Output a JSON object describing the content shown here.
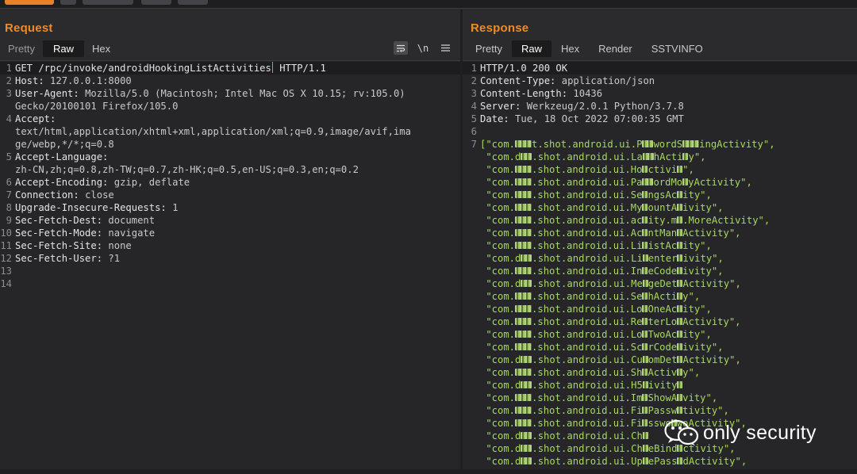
{
  "request": {
    "title": "Request",
    "tabs": [
      "Pretty",
      "Raw",
      "Hex"
    ],
    "active_tab": "Raw",
    "tools": [
      "wrap-icon",
      "newline-toggle",
      "menu-icon"
    ],
    "newline_label": "\\n",
    "lines": [
      {
        "n": "1",
        "parts": [
          [
            "txt",
            "GET /rpc/invoke/androidHookingListActivities"
          ],
          [
            "cursor",
            ""
          ],
          [
            "txt",
            " HTTP/1.1"
          ]
        ],
        "hl": true
      },
      {
        "n": "2",
        "parts": [
          [
            "key",
            "Host: "
          ],
          [
            "val",
            "127.0.0.1:8000"
          ]
        ]
      },
      {
        "n": "3",
        "parts": [
          [
            "key",
            "User-Agent: "
          ],
          [
            "val",
            "Mozilla/5.0 (Macintosh; Intel Mac OS X 10.15; rv:105.0)"
          ]
        ]
      },
      {
        "n": "",
        "parts": [
          [
            "val",
            "Gecko/20100101 Firefox/105.0"
          ]
        ]
      },
      {
        "n": "4",
        "parts": [
          [
            "key",
            "Accept:"
          ]
        ]
      },
      {
        "n": "",
        "parts": [
          [
            "val",
            "text/html,application/xhtml+xml,application/xml;q=0.9,image/avif,ima"
          ]
        ]
      },
      {
        "n": "",
        "parts": [
          [
            "val",
            "ge/webp,*/*;q=0.8"
          ]
        ]
      },
      {
        "n": "5",
        "parts": [
          [
            "key",
            "Accept-Language:"
          ]
        ]
      },
      {
        "n": "",
        "parts": [
          [
            "val",
            "zh-CN,zh;q=0.8,zh-TW;q=0.7,zh-HK;q=0.5,en-US;q=0.3,en;q=0.2"
          ]
        ]
      },
      {
        "n": "6",
        "parts": [
          [
            "key",
            "Accept-Encoding: "
          ],
          [
            "val",
            "gzip, deflate"
          ]
        ]
      },
      {
        "n": "7",
        "parts": [
          [
            "key",
            "Connection: "
          ],
          [
            "val",
            "close"
          ]
        ]
      },
      {
        "n": "8",
        "parts": [
          [
            "key",
            "Upgrade-Insecure-Requests: "
          ],
          [
            "val",
            "1"
          ]
        ]
      },
      {
        "n": "9",
        "parts": [
          [
            "key",
            "Sec-Fetch-Dest: "
          ],
          [
            "val",
            "document"
          ]
        ]
      },
      {
        "n": "10",
        "parts": [
          [
            "key",
            "Sec-Fetch-Mode: "
          ],
          [
            "val",
            "navigate"
          ]
        ]
      },
      {
        "n": "11",
        "parts": [
          [
            "key",
            "Sec-Fetch-Site: "
          ],
          [
            "val",
            "none"
          ]
        ]
      },
      {
        "n": "12",
        "parts": [
          [
            "key",
            "Sec-Fetch-User: "
          ],
          [
            "val",
            "?1"
          ]
        ]
      },
      {
        "n": "13",
        "parts": []
      },
      {
        "n": "14",
        "parts": []
      }
    ]
  },
  "response": {
    "title": "Response",
    "tabs": [
      "Pretty",
      "Raw",
      "Hex",
      "Render",
      "SSTVINFO"
    ],
    "active_tab": "Raw",
    "lines": [
      {
        "n": "1",
        "parts": [
          [
            "key",
            "HTTP/1.0 200 OK"
          ]
        ],
        "hl": true
      },
      {
        "n": "2",
        "parts": [
          [
            "key",
            "Content-Type: "
          ],
          [
            "val",
            "application/json"
          ]
        ]
      },
      {
        "n": "3",
        "parts": [
          [
            "key",
            "Content-Length: "
          ],
          [
            "val",
            "10436"
          ]
        ]
      },
      {
        "n": "4",
        "parts": [
          [
            "key",
            "Server: "
          ],
          [
            "val",
            "Werkzeug/2.0.1 Python/3.7.8"
          ]
        ]
      },
      {
        "n": "5",
        "parts": [
          [
            "key",
            "Date: "
          ],
          [
            "val",
            "Tue, 18 Oct 2022 07:00:35 GMT"
          ]
        ]
      },
      {
        "n": "6",
        "parts": []
      },
      {
        "n": "7",
        "parts": [
          [
            "str",
            "[\"com."
          ],
          [
            "blur",
            "3"
          ],
          [
            "str",
            "t.shot.android.ui.P"
          ],
          [
            "blur",
            "2"
          ],
          [
            "str",
            "wordS"
          ],
          [
            "blur",
            "3"
          ],
          [
            "str",
            "ingActivity\","
          ]
        ]
      },
      {
        "n": "",
        "parts": [
          [
            "str",
            " \"com.d"
          ],
          [
            "blur",
            "2"
          ],
          [
            "str",
            ".shot.android.ui.La"
          ],
          [
            "blur",
            "2"
          ],
          [
            "str",
            "hActi"
          ],
          [
            "blur",
            "1"
          ],
          [
            "str",
            "y\","
          ]
        ]
      },
      {
        "n": "",
        "parts": [
          [
            "str",
            " \"com."
          ],
          [
            "blur",
            "3"
          ],
          [
            "str",
            ".shot.android.ui.Ho"
          ],
          [
            "blur",
            "1"
          ],
          [
            "str",
            "ctivi"
          ],
          [
            "blur",
            "1"
          ],
          [
            "str",
            "\","
          ]
        ]
      },
      {
        "n": "",
        "parts": [
          [
            "str",
            " \"com."
          ],
          [
            "blur",
            "3"
          ],
          [
            "str",
            ".shot.android.ui.Pa"
          ],
          [
            "blur",
            "2"
          ],
          [
            "str",
            "ordMo"
          ],
          [
            "blur",
            "1"
          ],
          [
            "str",
            "yActivity\","
          ]
        ]
      },
      {
        "n": "",
        "parts": [
          [
            "str",
            " \"com."
          ],
          [
            "blur",
            "3"
          ],
          [
            "str",
            ".shot.android.ui.Se"
          ],
          [
            "blur",
            "1"
          ],
          [
            "str",
            "ngsAc"
          ],
          [
            "blur",
            "1"
          ],
          [
            "str",
            "ity\","
          ]
        ]
      },
      {
        "n": "",
        "parts": [
          [
            "str",
            " \"com."
          ],
          [
            "blur",
            "3"
          ],
          [
            "str",
            ".shot.android.ui.My"
          ],
          [
            "blur",
            "1"
          ],
          [
            "str",
            "ountA"
          ],
          [
            "blur",
            "1"
          ],
          [
            "str",
            "ivity\","
          ]
        ]
      },
      {
        "n": "",
        "parts": [
          [
            "str",
            " \"com."
          ],
          [
            "blur",
            "3"
          ],
          [
            "str",
            ".shot.android.ui.ac"
          ],
          [
            "blur",
            "1"
          ],
          [
            "str",
            "ity.m"
          ],
          [
            "blur",
            "1"
          ],
          [
            "str",
            ".MoreActivity\","
          ]
        ]
      },
      {
        "n": "",
        "parts": [
          [
            "str",
            " \"com."
          ],
          [
            "blur",
            "3"
          ],
          [
            "str",
            ".shot.android.ui.Ac"
          ],
          [
            "blur",
            "1"
          ],
          [
            "str",
            "ntMan"
          ],
          [
            "blur",
            "1"
          ],
          [
            "str",
            "Activity\","
          ]
        ]
      },
      {
        "n": "",
        "parts": [
          [
            "str",
            " \"com."
          ],
          [
            "blur",
            "3"
          ],
          [
            "str",
            ".shot.android.ui.Li"
          ],
          [
            "blur",
            "1"
          ],
          [
            "str",
            "istAc"
          ],
          [
            "blur",
            "1"
          ],
          [
            "str",
            "ity\","
          ]
        ]
      },
      {
        "n": "",
        "parts": [
          [
            "str",
            " \"com.d"
          ],
          [
            "blur",
            "2"
          ],
          [
            "str",
            ".shot.android.ui.Li"
          ],
          [
            "blur",
            "1"
          ],
          [
            "str",
            "enter"
          ],
          [
            "blur",
            "1"
          ],
          [
            "str",
            "ivity\","
          ]
        ]
      },
      {
        "n": "",
        "parts": [
          [
            "str",
            " \"com."
          ],
          [
            "blur",
            "3"
          ],
          [
            "str",
            ".shot.android.ui.In"
          ],
          [
            "blur",
            "1"
          ],
          [
            "str",
            "eCode"
          ],
          [
            "blur",
            "1"
          ],
          [
            "str",
            "ivity\","
          ]
        ]
      },
      {
        "n": "",
        "parts": [
          [
            "str",
            " \"com.d"
          ],
          [
            "blur",
            "2"
          ],
          [
            "str",
            ".shot.android.ui.Me"
          ],
          [
            "blur",
            "1"
          ],
          [
            "str",
            "geDet"
          ],
          [
            "blur",
            "1"
          ],
          [
            "str",
            "Activity\","
          ]
        ]
      },
      {
        "n": "",
        "parts": [
          [
            "str",
            " \"com."
          ],
          [
            "blur",
            "3"
          ],
          [
            "str",
            ".shot.android.ui.Se"
          ],
          [
            "blur",
            "1"
          ],
          [
            "str",
            "hActi"
          ],
          [
            "blur",
            "1"
          ],
          [
            "str",
            "y\","
          ]
        ]
      },
      {
        "n": "",
        "parts": [
          [
            "str",
            " \"com."
          ],
          [
            "blur",
            "3"
          ],
          [
            "str",
            ".shot.android.ui.Lo"
          ],
          [
            "blur",
            "1"
          ],
          [
            "str",
            "OneAc"
          ],
          [
            "blur",
            "1"
          ],
          [
            "str",
            "ity\","
          ]
        ]
      },
      {
        "n": "",
        "parts": [
          [
            "str",
            " \"com."
          ],
          [
            "blur",
            "3"
          ],
          [
            "str",
            ".shot.android.ui.Re"
          ],
          [
            "blur",
            "1"
          ],
          [
            "str",
            "terLo"
          ],
          [
            "blur",
            "1"
          ],
          [
            "str",
            "Activity\","
          ]
        ]
      },
      {
        "n": "",
        "parts": [
          [
            "str",
            " \"com."
          ],
          [
            "blur",
            "3"
          ],
          [
            "str",
            ".shot.android.ui.Lo"
          ],
          [
            "blur",
            "1"
          ],
          [
            "str",
            "TwoAc"
          ],
          [
            "blur",
            "1"
          ],
          [
            "str",
            "ity\","
          ]
        ]
      },
      {
        "n": "",
        "parts": [
          [
            "str",
            " \"com."
          ],
          [
            "blur",
            "3"
          ],
          [
            "str",
            ".shot.android.ui.Sc"
          ],
          [
            "blur",
            "1"
          ],
          [
            "str",
            "rCode"
          ],
          [
            "blur",
            "1"
          ],
          [
            "str",
            "ivity\","
          ]
        ]
      },
      {
        "n": "",
        "parts": [
          [
            "str",
            " \"com.d"
          ],
          [
            "blur",
            "2"
          ],
          [
            "str",
            ".shot.android.ui.Cu"
          ],
          [
            "blur",
            "1"
          ],
          [
            "str",
            "omDet"
          ],
          [
            "blur",
            "1"
          ],
          [
            "str",
            "Activity\","
          ]
        ]
      },
      {
        "n": "",
        "parts": [
          [
            "str",
            " \"com."
          ],
          [
            "blur",
            "3"
          ],
          [
            "str",
            ".shot.android.ui.Sh"
          ],
          [
            "blur",
            "1"
          ],
          [
            "str",
            "Activ"
          ],
          [
            "blur",
            "1"
          ],
          [
            "str",
            "y\","
          ]
        ]
      },
      {
        "n": "",
        "parts": [
          [
            "str",
            " \"com.d"
          ],
          [
            "blur",
            "2"
          ],
          [
            "str",
            ".shot.android.ui.H5"
          ],
          [
            "blur",
            "1"
          ],
          [
            "str",
            "ivity"
          ],
          [
            "blur",
            "1"
          ],
          [
            "str",
            ""
          ]
        ]
      },
      {
        "n": "",
        "parts": [
          [
            "str",
            " \"com."
          ],
          [
            "blur",
            "3"
          ],
          [
            "str",
            ".shot.android.ui.Im"
          ],
          [
            "blur",
            "1"
          ],
          [
            "str",
            "ShowA"
          ],
          [
            "blur",
            "1"
          ],
          [
            "str",
            "vity\","
          ]
        ]
      },
      {
        "n": "",
        "parts": [
          [
            "str",
            " \"com."
          ],
          [
            "blur",
            "3"
          ],
          [
            "str",
            ".shot.android.ui.Fi"
          ],
          [
            "blur",
            "1"
          ],
          [
            "str",
            "Passw"
          ],
          [
            "blur",
            "1"
          ],
          [
            "str",
            "tivity\","
          ]
        ]
      },
      {
        "n": "",
        "parts": [
          [
            "str",
            " \"com."
          ],
          [
            "blur",
            "3"
          ],
          [
            "str",
            ".shot.android.ui.Fi"
          ],
          [
            "blur",
            "1"
          ],
          [
            "str",
            "sswo"
          ],
          [
            "blur",
            "1"
          ],
          [
            "str",
            "woActivity\","
          ]
        ]
      },
      {
        "n": "",
        "parts": [
          [
            "str",
            " \"com.d"
          ],
          [
            "blur",
            "2"
          ],
          [
            "str",
            ".shot.android.ui.Ch"
          ],
          [
            "blur",
            "1"
          ],
          [
            "str",
            ""
          ]
        ]
      },
      {
        "n": "",
        "parts": [
          [
            "str",
            " \"com.d"
          ],
          [
            "blur",
            "2"
          ],
          [
            "str",
            ".shot.android.ui.Ch"
          ],
          [
            "blur",
            "1"
          ],
          [
            "str",
            "eBind"
          ],
          [
            "blur",
            "1"
          ],
          [
            "str",
            "ctivity\","
          ]
        ]
      },
      {
        "n": "",
        "parts": [
          [
            "str",
            " \"com.d"
          ],
          [
            "blur",
            "2"
          ],
          [
            "str",
            ".shot.android.ui.Up"
          ],
          [
            "blur",
            "1"
          ],
          [
            "str",
            "ePass"
          ],
          [
            "blur",
            "1"
          ],
          [
            "str",
            "dActivity\","
          ]
        ]
      }
    ]
  },
  "watermark": {
    "text": "only security"
  },
  "colors": {
    "accent": "#f08a24",
    "string": "#a7d95a",
    "background": "#262628"
  }
}
